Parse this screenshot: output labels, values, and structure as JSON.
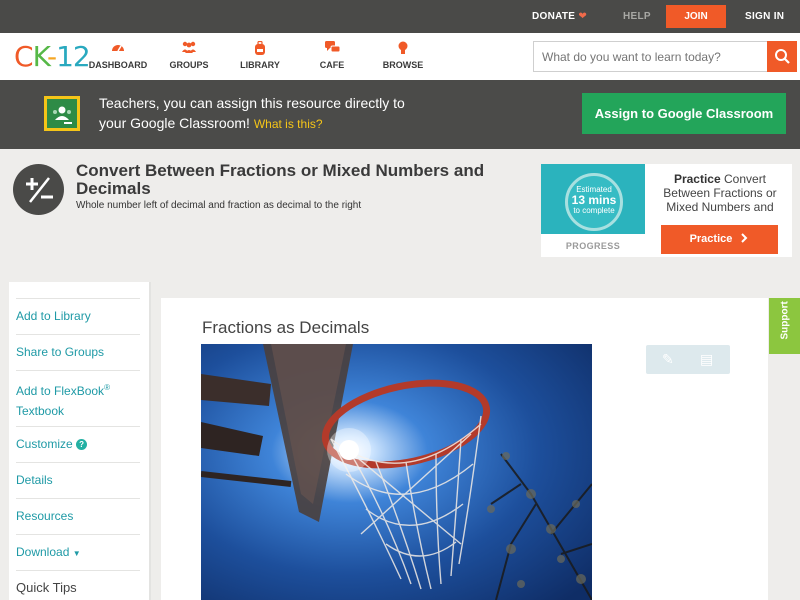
{
  "topbar": {
    "donate": "DONATE",
    "help": "HELP",
    "join": "JOIN",
    "signin": "SIGN IN"
  },
  "nav": {
    "logo": {
      "c": "C",
      "k": "K",
      "dash": "-",
      "num": "12"
    },
    "items": [
      {
        "label": "DASHBOARD",
        "icon": "dashboard-gauge-icon"
      },
      {
        "label": "GROUPS",
        "icon": "groups-people-icon"
      },
      {
        "label": "LIBRARY",
        "icon": "library-backpack-icon"
      },
      {
        "label": "CAFE",
        "icon": "cafe-chat-icon"
      },
      {
        "label": "BROWSE",
        "icon": "browse-lightbulb-icon"
      }
    ],
    "search_placeholder": "What do you want to learn today?"
  },
  "banner": {
    "line1": "Teachers, you can assign this resource directly to",
    "line2": "your Google Classroom!",
    "what": "What is this?",
    "assign_button": "Assign to Google Classroom"
  },
  "header": {
    "title": "Convert Between Fractions or Mixed Numbers and Decimals",
    "subtitle": "Whole number left of decimal and fraction as decimal to the right"
  },
  "practice": {
    "estimated": "Estimated",
    "mins": "13 mins",
    "to_complete": "to complete",
    "progress": "PROGRESS",
    "bold": "Practice",
    "text": "Convert Between Fractions or Mixed Numbers and",
    "button": "Practice"
  },
  "sidebar": {
    "add_library": "Add to Library",
    "share_groups": "Share to Groups",
    "add_flexbook_1": "Add to FlexBook",
    "add_flexbook_reg": "®",
    "add_flexbook_2": "Textbook",
    "customize": "Customize",
    "details": "Details",
    "resources": "Resources",
    "download": "Download",
    "quick_tips": "Quick Tips"
  },
  "content": {
    "title": "Fractions as Decimals"
  },
  "support": "Support",
  "colors": {
    "accent_orange": "#f05a28",
    "classroom_green": "#23a55a",
    "link_teal": "#1f9aa6",
    "support_green": "#8cc63f"
  }
}
